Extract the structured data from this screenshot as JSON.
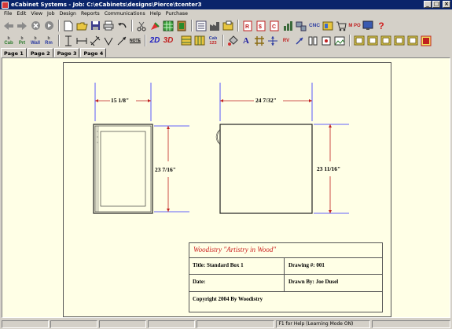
{
  "window": {
    "title": "eCabinet Systems - Job: C:\\eCabinets\\designs\\Pierce\\tcenter3",
    "controls": {
      "minimize": "_",
      "maximize": "□",
      "close": "×"
    }
  },
  "menu": [
    "File",
    "Edit",
    "View",
    "Job",
    "Design",
    "Reports",
    "Communications",
    "Help",
    "Purchase"
  ],
  "toolbar1": {
    "cnc_label": "CNC",
    "mpo_label": "M PO",
    "help_glyph": "?"
  },
  "toolbar2": {
    "cab_label": "Cab",
    "prt_label": "Prt",
    "wall_label": "Wall",
    "rm_label": "Rm",
    "note_label": "NOTE",
    "view2d": "2D",
    "view3d": "3D",
    "cab123_top": "Cab",
    "cab123_bottom": "123",
    "text_tool": "A",
    "rv_label": "RV"
  },
  "tabs": [
    "Page 1",
    "Page 2",
    "Page 3",
    "Page 4"
  ],
  "drawing": {
    "front_width": "15 1/8\"",
    "front_height": "23 7/16\"",
    "side_depth": "24 7/32\"",
    "side_height": "23 11/16\""
  },
  "title_block": {
    "company": "Woodistry   \"Artistry in Wood\"",
    "title": "Title: Standard Box 1",
    "drawing_no": "Drawing #: 001",
    "date": "Date:",
    "drawn_by": "Drawn By:  Joe Dusel",
    "copyright": "Copyright 2004 By Woodistry"
  },
  "status": {
    "help_text": "F1 for Help (Learning Mode ON)"
  },
  "colors": {
    "titlebar": "#0a246a",
    "workspace": "#ffffe6",
    "dimension_line": "#3030ff",
    "company_text": "#cc2020",
    "chrome": "#d4d0c8"
  }
}
